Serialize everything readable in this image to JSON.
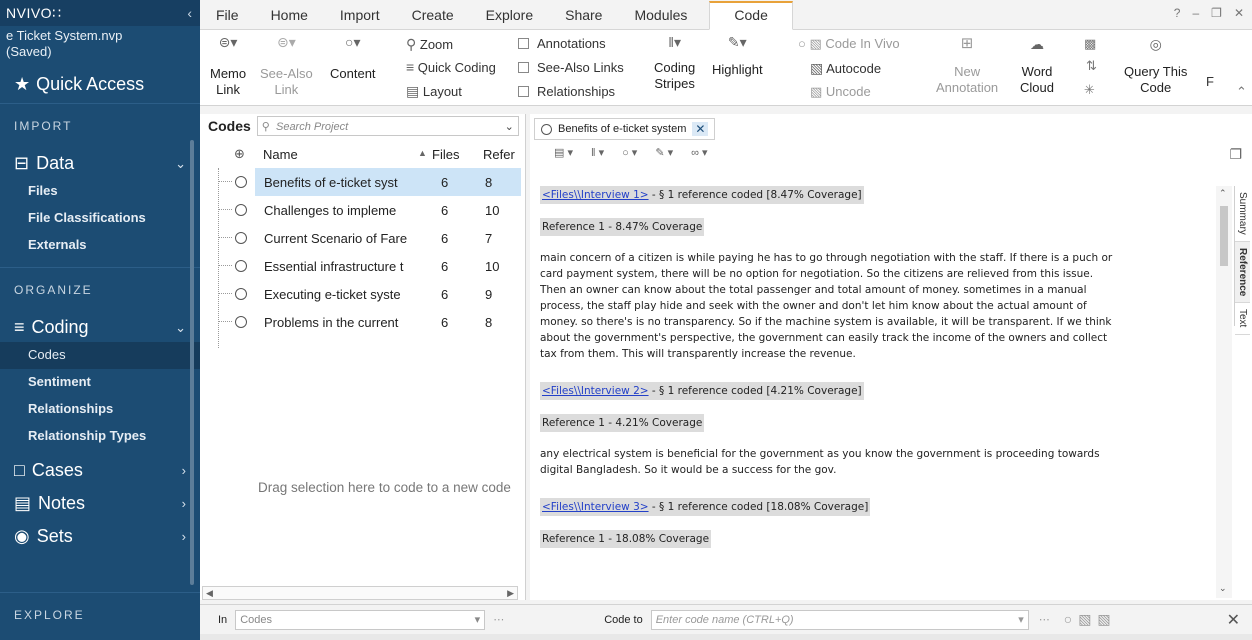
{
  "sidebar": {
    "logo": "NVIVO∷",
    "collapse_glyph": "‹",
    "project_name": "e Ticket System.nvp",
    "project_status": "(Saved)",
    "quick_access": "Quick Access",
    "sections": {
      "import": "IMPORT",
      "organize": "ORGANIZE",
      "explore": "EXPLORE"
    },
    "data_group": {
      "label": "Data",
      "items": [
        "Files",
        "File Classifications",
        "Externals"
      ]
    },
    "coding_group": {
      "label": "Coding",
      "items": [
        "Codes",
        "Sentiment",
        "Relationships",
        "Relationship Types"
      ],
      "active": "Codes"
    },
    "cases_label": "Cases",
    "notes_label": "Notes",
    "sets_label": "Sets",
    "colors": {
      "bg": "#1c4c73",
      "active": "#163c5c"
    }
  },
  "ribbon": {
    "tabs": [
      "File",
      "Home",
      "Import",
      "Create",
      "Explore",
      "Share",
      "Modules",
      "Code"
    ],
    "active_tab": "Code",
    "accent": "#e8a23a",
    "memo_link": [
      "Memo",
      "Link"
    ],
    "see_also_link": [
      "See-Also",
      "Link"
    ],
    "content": "Content",
    "zoom": "Zoom",
    "quick_coding": "Quick Coding",
    "layout": "Layout",
    "annotations": "Annotations",
    "see_also_links": "See-Also Links",
    "relationships": "Relationships",
    "coding_stripes": [
      "Coding",
      "Stripes"
    ],
    "highlight": "Highlight",
    "code_in_vivo": "Code In Vivo",
    "autocode": "Autocode",
    "uncode": "Uncode",
    "new_annotation": [
      "New",
      "Annotation"
    ],
    "word_cloud": [
      "Word",
      "Cloud"
    ],
    "query_this_code": [
      "Query This",
      "Code"
    ],
    "f_cut": "F"
  },
  "codes_pane": {
    "title": "Codes",
    "search_placeholder": "Search Project",
    "columns": {
      "name": "Name",
      "files": "Files",
      "refs": "Refer"
    },
    "rows": [
      {
        "name": "Benefits of e-ticket syst",
        "files": "6",
        "refs": "8"
      },
      {
        "name": "Challenges to impleme",
        "files": "6",
        "refs": "10"
      },
      {
        "name": "Current Scenario of Fare",
        "files": "6",
        "refs": "7"
      },
      {
        "name": "Essential infrastructure t",
        "files": "6",
        "refs": "10"
      },
      {
        "name": "Executing e-ticket syste",
        "files": "6",
        "refs": "9"
      },
      {
        "name": "Problems in the current",
        "files": "6",
        "refs": "8"
      }
    ],
    "drag_hint": "Drag selection here to code to a new code"
  },
  "detail_pane": {
    "tab_label": "Benefits of e-ticket system",
    "side_tabs": [
      "Summary",
      "Reference",
      "Text"
    ],
    "entries": [
      {
        "link": "<Files\\\\Interview 1>",
        "meta": " - § 1 reference coded  [8.47% Coverage]",
        "reference": "Reference 1 - 8.47% Coverage",
        "text": "main concern of a citizen is while paying he has to go through negotiation with the staff. If there is a puch or card payment system, there will be no option for negotiation. So the citizens are relieved from this issue. Then an owner can know about the total passenger and total amount of money. sometimes in a manual process, the staff play hide and seek with the owner and don't let him know about the actual amount of money. so there's is no transparency. So if the machine system is available, it will be transparent. If we think about the government's perspective, the government can easily track the income of the owners and collect tax from them. This will transparently increase the revenue."
      },
      {
        "link": "<Files\\\\Interview 2>",
        "meta": " - § 1 reference coded  [4.21% Coverage]",
        "reference": "Reference 1 - 4.21% Coverage",
        "text": "any electrical system is beneficial for the government as you know the government is proceeding towards digital Bangladesh. So it would be a success for the gov."
      },
      {
        "link": "<Files\\\\Interview 3>",
        "meta": " - § 1 reference coded  [18.08% Coverage]",
        "reference": "Reference 1 - 18.08% Coverage",
        "text": ""
      }
    ]
  },
  "bottom_bar": {
    "in_label": "In",
    "in_value": "Codes",
    "code_to_label": "Code to",
    "code_to_placeholder": "Enter code name (CTRL+Q)"
  }
}
